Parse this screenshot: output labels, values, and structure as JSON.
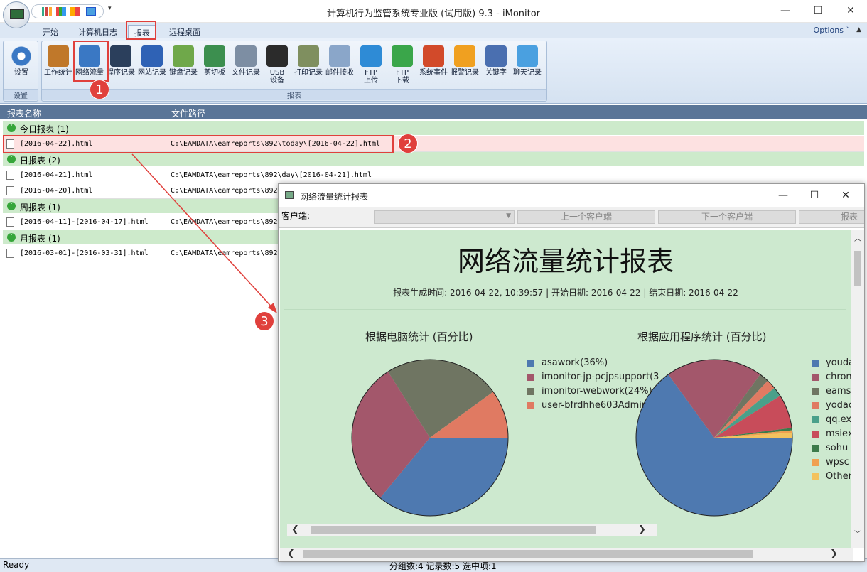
{
  "app": {
    "title": "计算机行为监管系统专业版 (试用版) 9.3 - iMonitor",
    "window_controls": [
      "—",
      "☐",
      "✕"
    ],
    "qat_dropdown": "▾"
  },
  "tabs": [
    {
      "label": "开始",
      "active": false
    },
    {
      "label": "计算机日志",
      "active": false
    },
    {
      "label": "报表",
      "active": true
    },
    {
      "label": "远程桌面",
      "active": false
    }
  ],
  "options_label": "Options ˅",
  "ribbon": {
    "settings_group": {
      "label": "设置",
      "button": "设置"
    },
    "report_group": {
      "label": "报表",
      "buttons": [
        {
          "label": "工作统计",
          "icon": "work-stats-icon",
          "color": "#c0782a"
        },
        {
          "label": "网络流量",
          "icon": "network-traffic-icon",
          "color": "#3a78c4"
        },
        {
          "label": "程序记录",
          "icon": "program-record-icon",
          "color": "#2b3f5c"
        },
        {
          "label": "网站记录",
          "icon": "website-record-icon",
          "color": "#2f62b5"
        },
        {
          "label": "键盘记录",
          "icon": "keyboard-record-icon",
          "color": "#6fa84a"
        },
        {
          "label": "剪切板",
          "icon": "clipboard-icon",
          "color": "#3c8f4f"
        },
        {
          "label": "文件记录",
          "icon": "file-record-icon",
          "color": "#7d8ea3"
        },
        {
          "label": "USB\n设备",
          "icon": "usb-device-icon",
          "color": "#2b2b2b"
        },
        {
          "label": "打印记录",
          "icon": "print-record-icon",
          "color": "#7f8f5f"
        },
        {
          "label": "邮件接收",
          "icon": "mail-receive-icon",
          "color": "#8aa6c9"
        },
        {
          "label": "FTP\n上传",
          "icon": "ftp-upload-icon",
          "color": "#2e8bd6"
        },
        {
          "label": "FTP\n下载",
          "icon": "ftp-download-icon",
          "color": "#3aa64a"
        },
        {
          "label": "系统事件",
          "icon": "system-event-icon",
          "color": "#d24a2a"
        },
        {
          "label": "报警记录",
          "icon": "alarm-record-icon",
          "color": "#f0a020"
        },
        {
          "label": "关键字",
          "icon": "keyword-icon",
          "color": "#4a6fb0"
        },
        {
          "label": "聊天记录",
          "icon": "chat-record-icon",
          "color": "#4aa0e0"
        }
      ]
    }
  },
  "annotations": [
    "1",
    "2",
    "3"
  ],
  "list": {
    "col_name": "报表名称",
    "col_path": "文件路径",
    "groups": [
      {
        "label": "今日报表 (1)",
        "rows": [
          {
            "name": "[2016-04-22].html",
            "path": "C:\\EAMDATA\\eamreports\\892\\today\\[2016-04-22].html",
            "selected": true
          }
        ]
      },
      {
        "label": "日报表 (2)",
        "rows": [
          {
            "name": "[2016-04-21].html",
            "path": "C:\\EAMDATA\\eamreports\\892\\day\\[2016-04-21].html"
          },
          {
            "name": "[2016-04-20].html",
            "path": "C:\\EAMDATA\\eamreports\\892"
          }
        ]
      },
      {
        "label": "周报表 (1)",
        "rows": [
          {
            "name": "[2016-04-11]-[2016-04-17].html",
            "path": "C:\\EAMDATA\\eamreports\\892"
          }
        ]
      },
      {
        "label": "月报表 (1)",
        "rows": [
          {
            "name": "[2016-03-01]-[2016-03-31].html",
            "path": "C:\\EAMDATA\\eamreports\\892"
          }
        ]
      }
    ]
  },
  "status": {
    "left": "Ready",
    "right": "分组数:4 记录数:5 选中项:1"
  },
  "report_window": {
    "title": "网络流量统计报表",
    "client_label": "客户端:",
    "prev_btn": "上一个客户端",
    "next_btn": "下一个客户端",
    "report_btn": "报表",
    "heading": "网络流量统计报表",
    "subheading": "报表生成时间: 2016-04-22, 10:39:57 | 开始日期: 2016-04-22 | 结束日期: 2016-04-22"
  },
  "chart_data": [
    {
      "type": "pie",
      "title": "根据电脑统计 (百分比)",
      "categories": [
        "asawork(36%)",
        "imonitor-jp-pcjpsupport(3",
        "imonitor-webwork(24%)",
        "user-bfrdhhe603Admir"
      ],
      "values": [
        36,
        30,
        24,
        10
      ],
      "colors": [
        "#4e79b0",
        "#a3576b",
        "#6f7562",
        "#e07a62"
      ]
    },
    {
      "type": "pie",
      "title": "根据应用程序统计 (百分比)",
      "categories": [
        "youda",
        "chron",
        "eams",
        "yodac",
        "qq.ex",
        "msiex",
        "sohu",
        "wpsc",
        "Other"
      ],
      "values": [
        65,
        20,
        2,
        2,
        2,
        7,
        0.5,
        0.5,
        1
      ],
      "colors": [
        "#4e79b0",
        "#a3576b",
        "#6f7562",
        "#e07a62",
        "#4aa08a",
        "#c84c5a",
        "#3c7a4a",
        "#f0a050",
        "#f3c25e"
      ]
    }
  ]
}
